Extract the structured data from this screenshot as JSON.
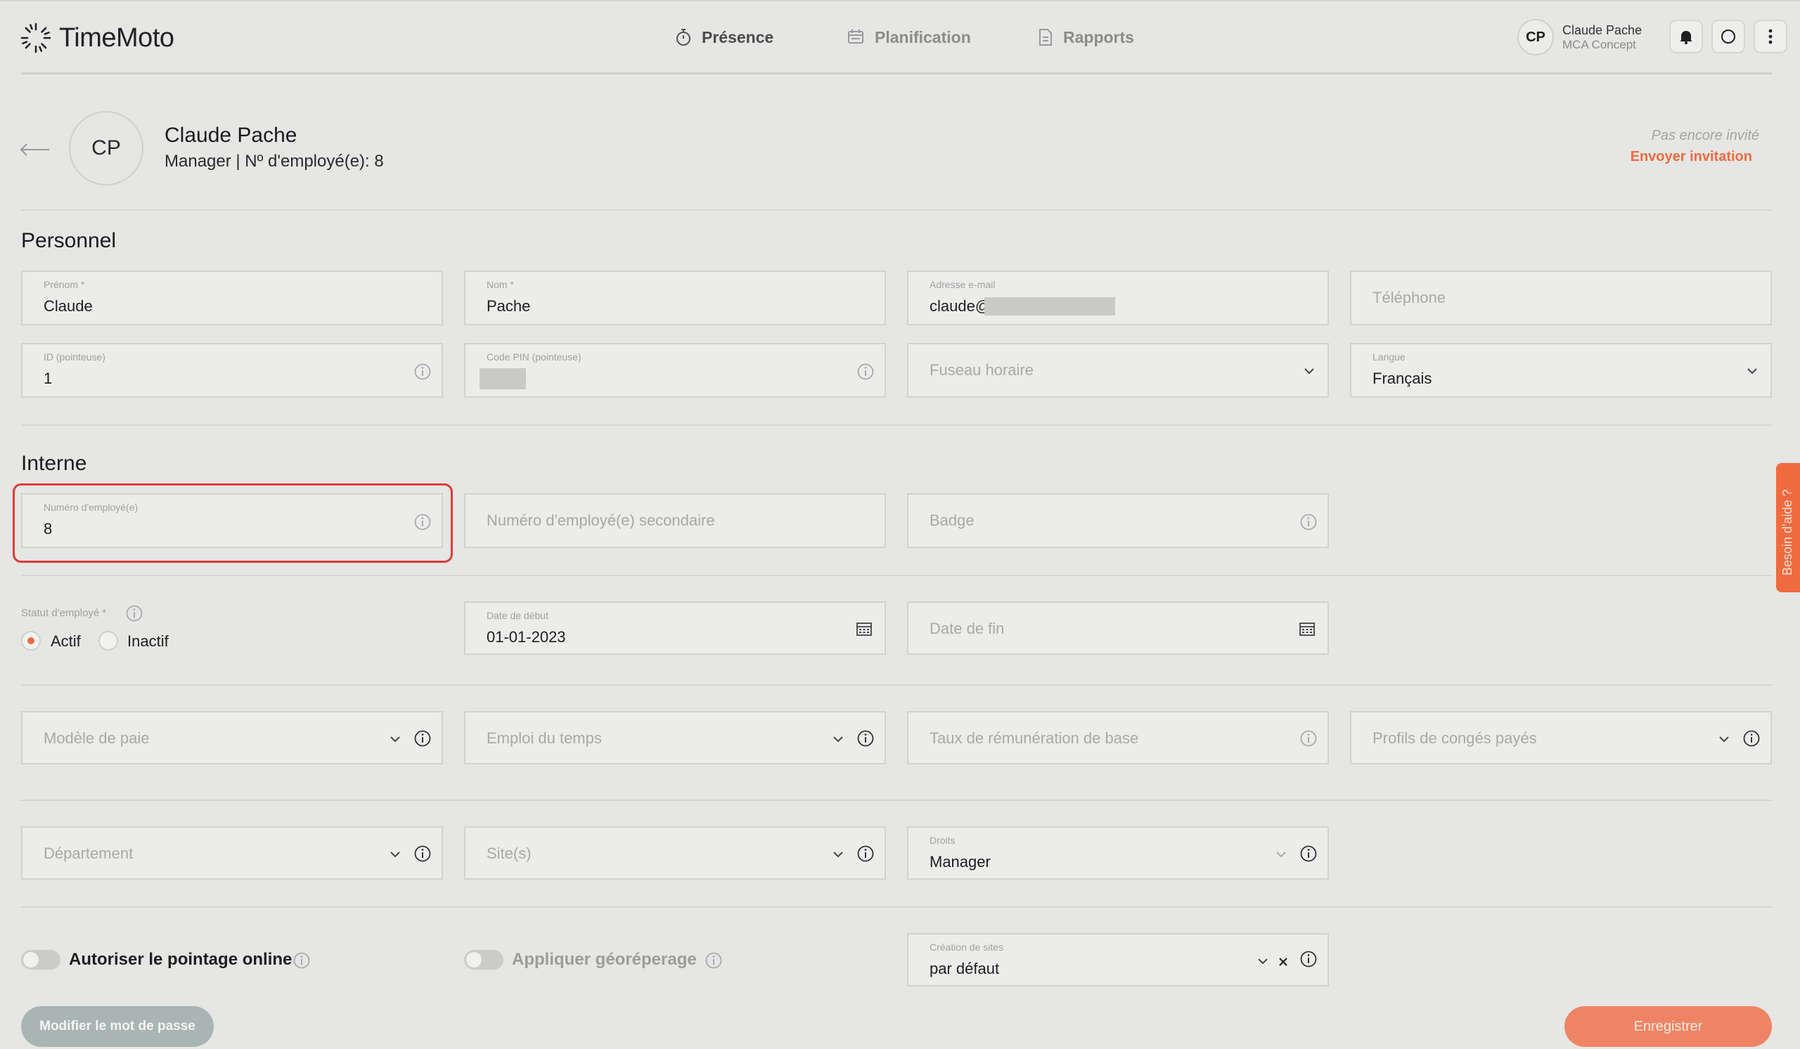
{
  "app": {
    "name": "TimeMoto"
  },
  "nav": [
    {
      "label": "Présence",
      "icon": "stopwatch-icon"
    },
    {
      "label": "Planification",
      "icon": "planning-icon"
    },
    {
      "label": "Rapports",
      "icon": "report-icon"
    }
  ],
  "user": {
    "initials": "CP",
    "name": "Claude Pache",
    "org": "MCA Concept"
  },
  "profile": {
    "initials": "CP",
    "name": "Claude Pache",
    "subtitle": "Manager | Nº d'employé(e): 8",
    "invite_status": "Pas encore invité",
    "invite_link": "Envoyer invitation"
  },
  "sections": {
    "personal": "Personnel",
    "internal": "Interne"
  },
  "personal": {
    "first_name": {
      "label": "Prénom *",
      "value": "Claude"
    },
    "last_name": {
      "label": "Nom *",
      "value": "Pache"
    },
    "email": {
      "label": "Adresse e-mail",
      "value": "claude@"
    },
    "phone": {
      "placeholder": "Téléphone"
    },
    "clock_id": {
      "label": "ID (pointeuse)",
      "value": "1"
    },
    "pin": {
      "label": "Code PIN (pointeuse)"
    },
    "timezone": {
      "placeholder": "Fuseau horaire"
    },
    "language": {
      "label": "Langue",
      "value": "Français"
    }
  },
  "internal": {
    "employee_number": {
      "label": "Numéro d'employé(e)",
      "value": "8"
    },
    "secondary_number": {
      "placeholder": "Numéro d'employé(e) secondaire"
    },
    "badge": {
      "placeholder": "Badge"
    },
    "status": {
      "label": "Statut d'employé *",
      "active": "Actif",
      "inactive": "Inactif",
      "selected": "Actif"
    },
    "start_date": {
      "label": "Date de début",
      "value": "01-01-2023"
    },
    "end_date": {
      "placeholder": "Date de fin"
    },
    "pay_model": {
      "placeholder": "Modèle de paie"
    },
    "schedule": {
      "placeholder": "Emploi du temps"
    },
    "base_rate": {
      "placeholder": "Taux de rémunération de base"
    },
    "leave_profiles": {
      "placeholder": "Profils de congés payés"
    },
    "department": {
      "placeholder": "Département"
    },
    "sites": {
      "placeholder": "Site(s)"
    },
    "rights": {
      "label": "Droits",
      "value": "Manager"
    },
    "online_clocking": {
      "label": "Autoriser le pointage online",
      "enabled": false
    },
    "geofencing": {
      "label": "Appliquer géoréperage",
      "enabled": false
    },
    "site_creation": {
      "label": "Création de sites",
      "value": "par défaut"
    }
  },
  "actions": {
    "change_password": "Modifier le mot de passe",
    "save": "Enregistrer"
  },
  "help": {
    "label": "Besoin d'aide ?"
  },
  "colors": {
    "accent": "#f06a3f",
    "highlight": "#e23b32",
    "background": "#e6e6e5"
  }
}
